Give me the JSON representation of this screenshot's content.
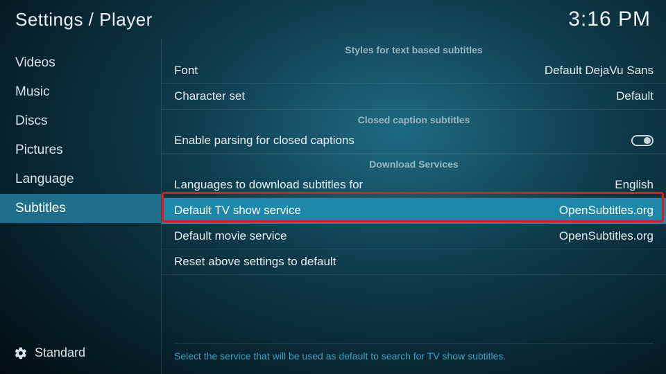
{
  "header": {
    "breadcrumb": "Settings / Player",
    "clock": "3:16 PM"
  },
  "sidebar": {
    "items": [
      {
        "label": "Videos"
      },
      {
        "label": "Music"
      },
      {
        "label": "Discs"
      },
      {
        "label": "Pictures"
      },
      {
        "label": "Language"
      },
      {
        "label": "Subtitles"
      }
    ],
    "level": "Standard"
  },
  "sections": {
    "styles": {
      "title": "Styles for text based subtitles",
      "font_label": "Font",
      "font_value": "Default DejaVu Sans",
      "charset_label": "Character set",
      "charset_value": "Default"
    },
    "cc": {
      "title": "Closed caption subtitles",
      "parse_label": "Enable parsing for closed captions"
    },
    "download": {
      "title": "Download Services",
      "langs_label": "Languages to download subtitles for",
      "langs_value": "English",
      "tv_label": "Default TV show service",
      "tv_value": "OpenSubtitles.org",
      "movie_label": "Default movie service",
      "movie_value": "OpenSubtitles.org",
      "reset_label": "Reset above settings to default"
    }
  },
  "help": "Select the service that will be used as default to search for TV show subtitles."
}
